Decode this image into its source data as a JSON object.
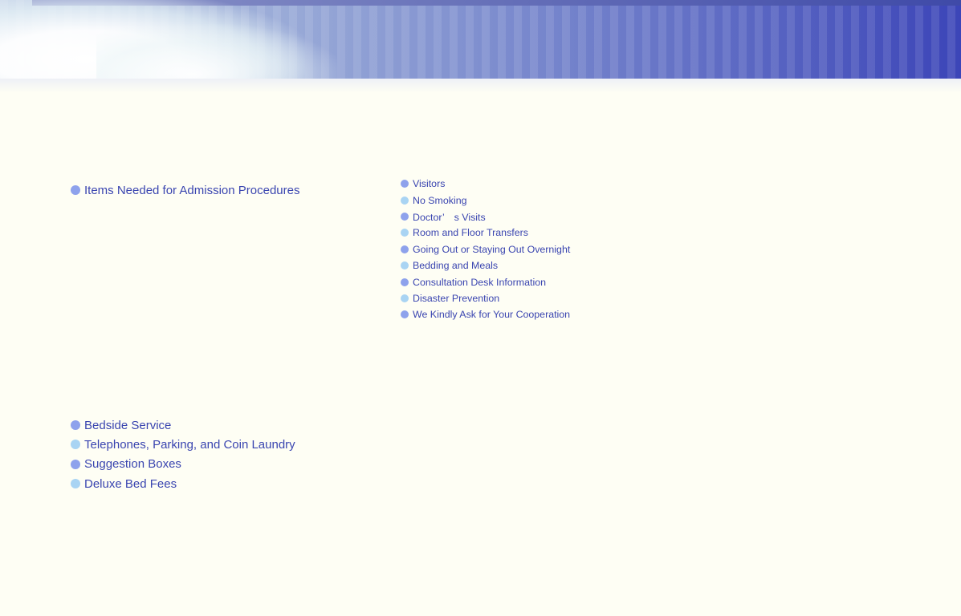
{
  "nav": {
    "admission": [
      {
        "label": "Items Needed for Admission Procedures",
        "dot": "blue"
      }
    ],
    "hospital_rules": [
      {
        "label": "Visitors",
        "dot": "blue"
      },
      {
        "label": "No Smoking",
        "dot": "light"
      },
      {
        "label": "Doctor’　s Visits",
        "dot": "blue"
      },
      {
        "label": "Room and Floor Transfers",
        "dot": "light"
      },
      {
        "label": "Going Out or Staying Out Overnight",
        "dot": "blue"
      },
      {
        "label": "Bedding and Meals",
        "dot": "light"
      },
      {
        "label": "Consultation Desk Information",
        "dot": "blue"
      },
      {
        "label": "Disaster Prevention",
        "dot": "light"
      },
      {
        "label": "We Kindly Ask for Your Cooperation",
        "dot": "blue"
      }
    ],
    "services": [
      {
        "label": "Bedside Service",
        "dot": "blue"
      },
      {
        "label": "Telephones, Parking, and Coin Laundry",
        "dot": "light"
      },
      {
        "label": "Suggestion Boxes",
        "dot": "blue"
      },
      {
        "label": "Deluxe Bed Fees",
        "dot": "light"
      }
    ]
  },
  "colors": {
    "link_text": "#3a45b0",
    "dot_blue": "#8ea2ec",
    "dot_light": "#a9d4f3",
    "background": "#fefef4"
  }
}
